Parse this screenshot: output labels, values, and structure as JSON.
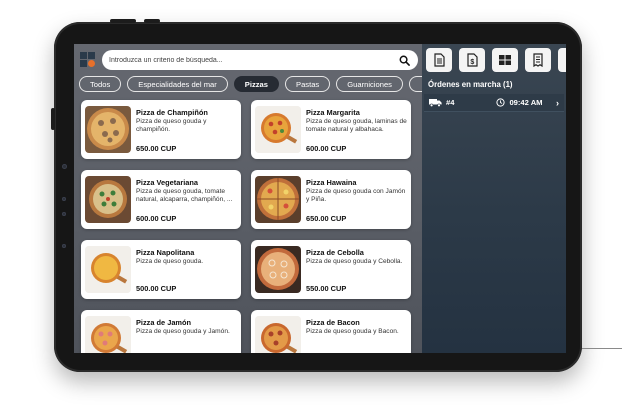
{
  "search": {
    "placeholder": "Introduzca un criterio de búsqueda..."
  },
  "tabs": [
    {
      "label": "Todos",
      "active": false
    },
    {
      "label": "Especialidades del mar",
      "active": false
    },
    {
      "label": "Pizzas",
      "active": true
    },
    {
      "label": "Pastas",
      "active": false
    },
    {
      "label": "Guarniciones",
      "active": false
    }
  ],
  "products": [
    {
      "name": "Pizza de Champiñón",
      "description": "Pizza de queso gouda y champiñón.",
      "price": "650.00 CUP",
      "image": "mushroom-pizza"
    },
    {
      "name": "Pizza Margarita",
      "description": "Pizza de queso gouda, laminas de tomate natural y albahaca.",
      "price": "600.00 CUP",
      "image": "margarita-pizza"
    },
    {
      "name": "Pizza Vegetariana",
      "description": "Pizza de queso gouda, tomate natural, alcaparra, champiñón, ...",
      "price": "600.00 CUP",
      "image": "vegetarian-pizza"
    },
    {
      "name": "Pizza Hawaina",
      "description": "Pizza de queso gouda con Jamón y Piña.",
      "price": "650.00 CUP",
      "image": "hawaiian-pizza"
    },
    {
      "name": "Pizza Napolitana",
      "description": "Pizza de queso gouda.",
      "price": "500.00 CUP",
      "image": "napolitana-pizza"
    },
    {
      "name": "Pizza de Cebolla",
      "description": "Pizza de queso gouda y Cebolla.",
      "price": "550.00 CUP",
      "image": "onion-pizza"
    },
    {
      "name": "Pizza de Jamón",
      "description": "Pizza de queso gouda y Jamón.",
      "price": "",
      "image": "ham-pizza"
    },
    {
      "name": "Pizza de Bacon",
      "description": "Pizza de queso gouda y Bacon.",
      "price": "",
      "image": "bacon-pizza"
    }
  ],
  "toolbar": {
    "icons": [
      "document-icon",
      "invoice-dollar-icon",
      "grid-icon",
      "receipt-icon"
    ]
  },
  "orders": {
    "title": "Órdenes en marcha (1)",
    "items": [
      {
        "number": "#4",
        "time": "09:42 AM",
        "icon": "delivery-truck-icon"
      }
    ]
  },
  "colors": {
    "accent_orange": "#e8702a",
    "logo_dark": "#2a3a4a",
    "active_tab": "#262b33"
  }
}
